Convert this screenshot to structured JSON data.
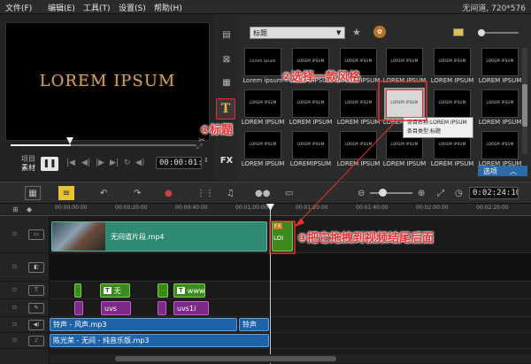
{
  "menu": {
    "file": "文件(F)",
    "edit": "编辑(E)",
    "tools": "工具(T)",
    "settings": "设置(S)",
    "help": "帮助(H)"
  },
  "project_info": "无间道, 720*576",
  "preview": {
    "title_text": "LOREM IPSUM",
    "mode_project": "项目",
    "mode_clip": "素材",
    "timecode": "00:00:01:06"
  },
  "library": {
    "category": "标题",
    "thumbnails": [
      {
        "text": "Lorem ipsum",
        "label": "Lorem ipsum"
      },
      {
        "text": "LOREM IPSUM",
        "label": "LOREM IPSUM"
      },
      {
        "text": "LOREM IPSUM",
        "label": "LOREM IPSUM"
      },
      {
        "text": "LOREM IPSUM",
        "label": "LOREM IPSUM"
      },
      {
        "text": "LOREM IPSUM",
        "label": "LOREM IPSUM"
      },
      {
        "text": "LOREM IPSUM",
        "label": "LOREM IPSUM"
      },
      {
        "text": "LOREM IPSUM",
        "label": "LOREM IPSUM"
      },
      {
        "text": "LOREM IPSUM",
        "label": "LOREM IPSUM"
      },
      {
        "text": "LOREM IPSUM",
        "label": "LOREM IPSUM"
      },
      {
        "text": "LOREM IPSUM",
        "label": "LOREM IPSUM"
      },
      {
        "text": "LOREM IPSUM",
        "label": "LOREM IPSUM"
      },
      {
        "text": "LOREM IPSUM",
        "label": "LOREM IPSUM"
      },
      {
        "text": "LOREM IPSUM",
        "label": "LOREM IPSUM"
      },
      {
        "text": "LOREM IPSUM",
        "label": "LOREMIPSUM"
      },
      {
        "text": "LOREM IPSUM",
        "label": "LOREM IPSUM"
      },
      {
        "text": "LOREM IPSUM",
        "label": "LOREM IPSUM"
      },
      {
        "text": "LOREM IPSUM",
        "label": "LOREM IPSUM"
      },
      {
        "text": "LOREM IPSUM",
        "label": "LOREM IPSUM"
      }
    ],
    "tooltip_line1": "条目名称:LOREM IPSUM",
    "tooltip_line2": "条目类型:标题",
    "options_label": "选项",
    "fx_label": "FX"
  },
  "timeline": {
    "timecode": "0:02:24:10",
    "ruler_ticks": [
      "00:00:00:00",
      "00:00:20:00",
      "00:00:40:00",
      "00:01:00:00",
      "00:01:20:00",
      "00:01:40:00",
      "00:02:00:00",
      "00:02:20:00"
    ],
    "video_clip_name": "无间道片段.mp4",
    "title_clip_fx": "FX",
    "title_clip_text": "LOI",
    "title_clip1": "无",
    "title_clip2": "www",
    "fx_clip1": "uvs",
    "fx_clip2": "uvs1i",
    "voice_clip1": "铃声 - 风声.mp3",
    "voice_clip2": "铃声",
    "music_clip": "陈光荣 - 无间 - 纯音乐版.mp3",
    "badge_t": "T"
  },
  "annotations": {
    "step1": "①标题",
    "step2": "②选择一款风格",
    "step3": "③把它拖拽到视频结尾后面"
  },
  "colors": {
    "annotation": "#e83030",
    "video_clip": "#2e8a72",
    "title_clip": "#3c8a1e",
    "music_clip": "#1e63a8",
    "fx_clip": "#7c2a8a"
  }
}
